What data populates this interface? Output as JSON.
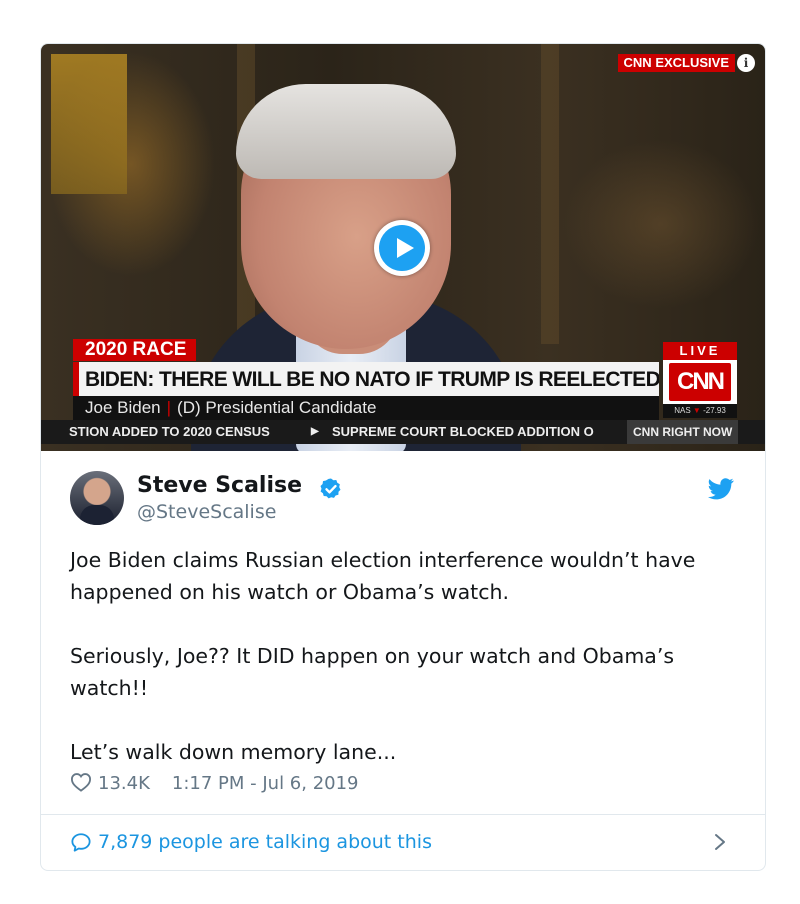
{
  "video": {
    "badge_brand": "CNN",
    "badge_text": "EXCLUSIVE",
    "info_glyph": "i",
    "chyron": {
      "category": "2020 RACE",
      "headline": "BIDEN: THERE WILL BE NO NATO IF TRUMP IS REELECTED",
      "name": "Joe Biden",
      "title": "(D) Presidential Candidate"
    },
    "live_label": "LIVE",
    "network_logo": "CNN",
    "stock": {
      "index": "NAS",
      "change": "-27.93"
    },
    "ticker": {
      "left": "STION ADDED TO 2020 CENSUS",
      "right": "SUPREME COURT BLOCKED ADDITION O",
      "segment": "CNN RIGHT NOW"
    },
    "accent_color": "#cc0000"
  },
  "tweet": {
    "author": {
      "display_name": "Steve Scalise",
      "handle": "@SteveScalise",
      "verified": true
    },
    "paragraphs": [
      "Joe Biden claims Russian election interference wouldn’t have happened on his watch or Obama’s watch.",
      "Seriously, Joe?? It DID happen on your watch and Obama’s watch!!",
      "Let’s walk down memory lane..."
    ],
    "likes": "13.4K",
    "timestamp": "1:17 PM - Jul 6, 2019"
  },
  "footer": {
    "talking_text": "7,879 people are talking about this"
  },
  "colors": {
    "twitter_blue": "#1da1f2",
    "link_blue": "#1b95e0",
    "muted": "#657786",
    "text": "#14171a"
  }
}
